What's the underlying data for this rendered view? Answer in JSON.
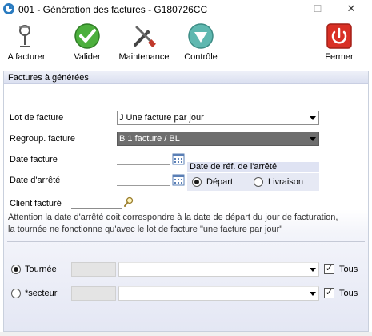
{
  "window": {
    "title": "001 - Génération des factures - G180726CC",
    "minimize": "—",
    "maximize": "☐",
    "close": "✕"
  },
  "toolbar": {
    "items": [
      {
        "label": "A facturer",
        "icon": "magnifier-lens-icon"
      },
      {
        "label": "Valider",
        "icon": "green-check-icon"
      },
      {
        "label": "Maintenance",
        "icon": "tools-icon"
      },
      {
        "label": "Contrôle",
        "icon": "triangle-down-icon"
      },
      {
        "label": "Fermer",
        "icon": "power-icon"
      }
    ]
  },
  "section": {
    "title": "Factures à générées"
  },
  "form": {
    "lot_label": "Lot de facture",
    "lot_value": "J Une facture par jour",
    "regroup_label": "Regroup. facture",
    "regroup_value": "B 1 facture / BL",
    "date_facture_label": "Date facture",
    "date_facture_value": "",
    "date_arrete_label": "Date d'arrêté",
    "date_arrete_value": "",
    "ref_group_title": "Date de réf. de l'arrêté",
    "ref_options": [
      {
        "label": "Départ",
        "selected": true
      },
      {
        "label": "Livraison",
        "selected": false
      }
    ],
    "client_label": "Client facturé",
    "client_value": ""
  },
  "notes": {
    "line1": "Attention la date d'arrêté doit correspondre à la date de départ du jour de facturation,",
    "line2": "la tournée ne fonctionne qu'avec le lot de facture \"une facture par jour\""
  },
  "filters": {
    "tournee_label": "Tournée",
    "tournee_selected": true,
    "tournee_code": "",
    "tournee_value": "",
    "tournee_all_label": "Tous",
    "tournee_all_checked": true,
    "secteur_label": "*secteur",
    "secteur_selected": false,
    "secteur_code": "",
    "secteur_value": "",
    "secteur_all_label": "Tous",
    "secteur_all_checked": true,
    "check_mark": "✓"
  },
  "colors": {
    "valider_green": "#4caf3d",
    "controle_teal": "#5fb8b0",
    "fermer_red": "#d93025",
    "section_blue": "#dadff0",
    "dark_combo": "#6e6e6e"
  }
}
